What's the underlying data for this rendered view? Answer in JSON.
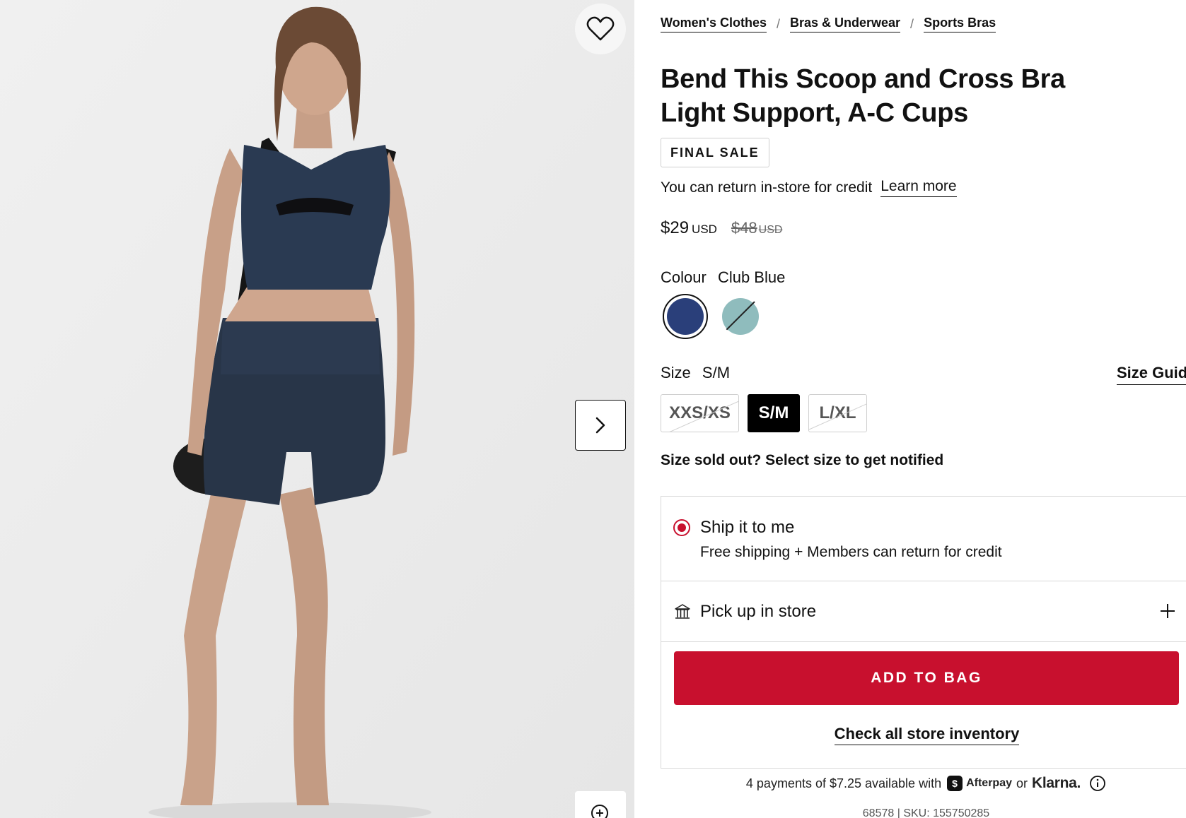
{
  "gallery": {
    "image_alt": "Bend This Scoop and Cross Bra Light Support, A-C Cups",
    "favorite_icon": "heart-icon",
    "next_icon": "chevron-right-icon",
    "zoom_icon": "zoom-in-icon"
  },
  "breadcrumb": [
    {
      "label": "Women's Clothes"
    },
    {
      "label": "Bras & Underwear"
    },
    {
      "label": "Sports Bras"
    }
  ],
  "breadcrumb_separator": "/",
  "product": {
    "title_line1": "Bend This Scoop and Cross Bra",
    "title_line2": "Light Support, A-C Cups",
    "badge": "FINAL SALE",
    "return_text": "You can return in-store for credit",
    "learn_more": "Learn more",
    "price": "$29",
    "currency": "USD",
    "old_price": "$48",
    "old_currency": "USD"
  },
  "colour": {
    "label": "Colour",
    "selected": "Club Blue",
    "swatches": [
      {
        "name": "Club Blue",
        "color": "#2a3f7a",
        "selected": true,
        "available": true
      },
      {
        "name": "Teal",
        "color": "#8fbcbd",
        "selected": false,
        "available": false
      }
    ]
  },
  "size": {
    "label": "Size",
    "selected": "S/M",
    "guide": "Size Guide",
    "options": [
      {
        "label": "XXS/XS",
        "selected": false,
        "available": false
      },
      {
        "label": "S/M",
        "selected": true,
        "available": true
      },
      {
        "label": "L/XL",
        "selected": false,
        "available": false
      }
    ],
    "sold_out_prompt": "Size sold out? Select size to get notified"
  },
  "fulfillment": {
    "ship_title": "Ship it to me",
    "ship_subtitle": "Free shipping + Members can return for credit",
    "pickup_title": "Pick up in store",
    "add_to_bag": "ADD TO BAG",
    "check_inventory": "Check all store inventory"
  },
  "payments": {
    "text": "4 payments of $7.25 available with",
    "afterpay": "Afterpay",
    "or": "or",
    "klarna": "Klarna."
  },
  "sku_line": "68578 | SKU: 155750285",
  "colors": {
    "accent_red": "#c8102e",
    "text": "#111111"
  }
}
